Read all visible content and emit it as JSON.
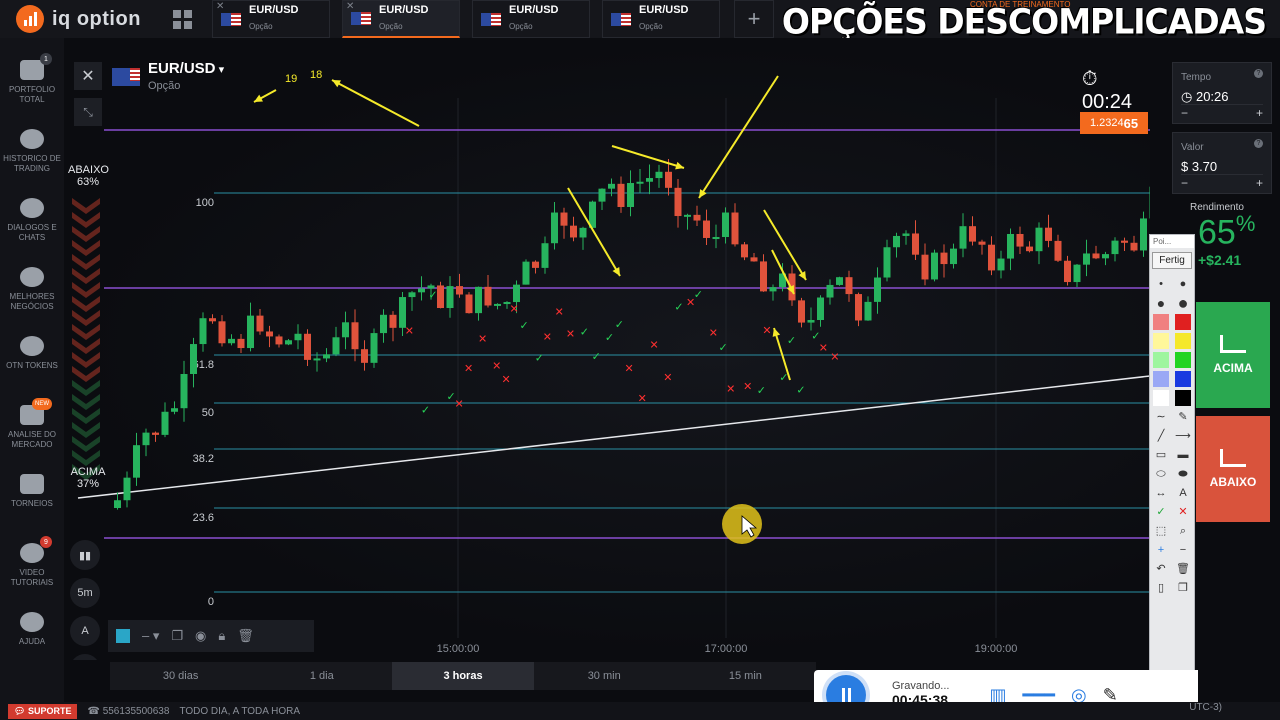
{
  "app": {
    "logo_text": "iq option"
  },
  "banner": {
    "text": "OPÇÕES DESCOMPLICADAS",
    "training": "CONTA DE TREINAMENTO"
  },
  "tabs": [
    {
      "pair": "EUR/USD",
      "type": "Opção",
      "active": false
    },
    {
      "pair": "EUR/USD",
      "type": "Opção",
      "active": true
    },
    {
      "pair": "EUR/USD",
      "type": "Opção",
      "active": false
    },
    {
      "pair": "EUR/USD",
      "type": "Opção",
      "active": false
    }
  ],
  "sidebar": {
    "items": [
      {
        "label": "PORTFOLIO TOTAL",
        "icon": "briefcase-icon",
        "badge": "1"
      },
      {
        "label": "HISTORICO DE TRADING",
        "icon": "history-icon"
      },
      {
        "label": "DIALOGOS E CHATS",
        "icon": "chat-icon"
      },
      {
        "label": "MELHORES NEGÓCIOS",
        "icon": "trophy-user-icon"
      },
      {
        "label": "OTN TOKENS",
        "icon": "token-icon"
      },
      {
        "label": "ANALISE DO MERCADO",
        "icon": "news-icon",
        "badge": "NEW"
      },
      {
        "label": "TORNEIOS",
        "icon": "cup-icon"
      },
      {
        "label": "VIDEO TUTORIAIS",
        "icon": "play-icon",
        "badge": "9"
      },
      {
        "label": "AJUDA",
        "icon": "help-icon"
      }
    ]
  },
  "chart": {
    "asset": "EUR/USD",
    "asset_type": "Opção",
    "timer": "00:24",
    "sentiment_down_label": "ABAIXO",
    "sentiment_down_pct": "63%",
    "sentiment_up_label": "ACIMA",
    "sentiment_up_pct": "37%",
    "current_price_prefix": "1.2324",
    "current_price_suffix": "65",
    "fib_levels": [
      "100",
      "61.8",
      "50",
      "38.2",
      "23.6",
      "0"
    ],
    "time_labels": [
      "15:00:00",
      "17:00:00",
      "19:00:00"
    ],
    "annotations": [
      "19",
      "18"
    ],
    "colors": {
      "up": "#27b45e",
      "down": "#e0533c",
      "accent": "#f36a1e",
      "fib": "#2a8fa3",
      "level": "#8a4fd0",
      "arrow": "#f5ea2a"
    }
  },
  "time_scale": {
    "options": [
      "30 dias",
      "1 dia",
      "3 horas",
      "30 min",
      "15 min"
    ],
    "selected": "3 horas"
  },
  "left_tools": [
    "chart-type",
    "5m",
    "A",
    "indicators"
  ],
  "trade_panel": {
    "time_label": "Tempo",
    "time_value": "20:26",
    "amount_label": "Valor",
    "amount_value": "$ 3.70",
    "yield_label": "Rendimento",
    "yield_pct": "65",
    "yield_profit": "+$2.41",
    "up_label": "ACIMA",
    "down_label": "ABAIXO"
  },
  "draw_toolbar": {
    "title": "Poi...",
    "done_label": "Fertig"
  },
  "recorder": {
    "status": "Gravando...",
    "elapsed": "00:45:38"
  },
  "status_bar": {
    "support_label": "SUPORTE",
    "phone": "556135500638",
    "hours": "TODO DIA, A TODA HORA",
    "timezone": "UTC-3)"
  }
}
